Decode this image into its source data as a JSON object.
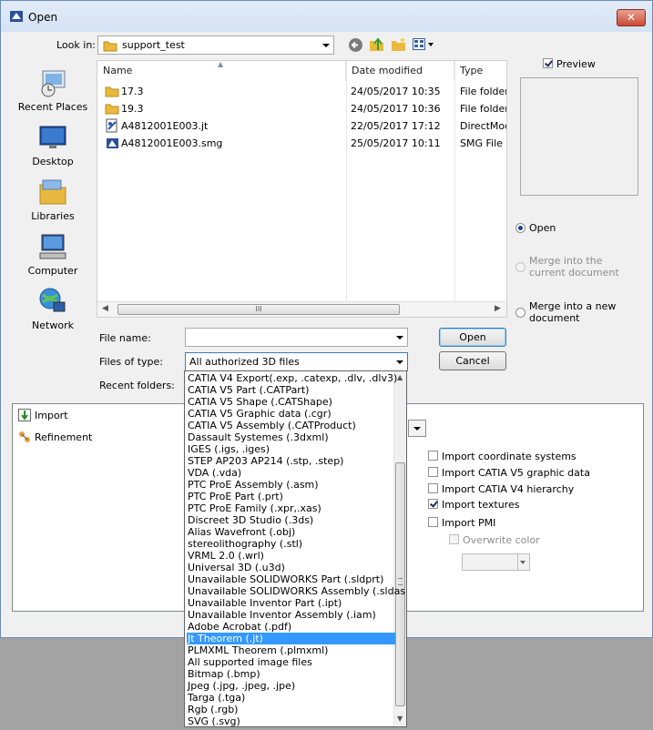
{
  "window": {
    "title": "Open",
    "close_glyph": "✕"
  },
  "toolbar": {
    "lookin_label": "Look in:",
    "lookin_value": "support_test"
  },
  "places": [
    {
      "label": "Recent Places",
      "icon": "recent-places-icon"
    },
    {
      "label": "Desktop",
      "icon": "desktop-icon"
    },
    {
      "label": "Libraries",
      "icon": "libraries-icon"
    },
    {
      "label": "Computer",
      "icon": "computer-icon"
    },
    {
      "label": "Network",
      "icon": "network-icon"
    }
  ],
  "filelist": {
    "columns": [
      "Name",
      "Date modified",
      "Type"
    ],
    "rows": [
      {
        "name": "17.3",
        "date": "24/05/2017 10:35",
        "type": "File folder",
        "icon": "folder-icon"
      },
      {
        "name": "19.3",
        "date": "24/05/2017 10:36",
        "type": "File folder",
        "icon": "folder-icon"
      },
      {
        "name": "A4812001E003.jt",
        "date": "22/05/2017 17:12",
        "type": "DirectMod",
        "icon": "jt-file-icon"
      },
      {
        "name": "A4812001E003.smg",
        "date": "25/05/2017 10:11",
        "type": "SMG File",
        "icon": "smg-file-icon"
      }
    ],
    "scroll_grip": "III"
  },
  "form": {
    "filename_label": "File name:",
    "filename_value": "",
    "filetype_label": "Files of type:",
    "filetype_value": "All authorized 3D files",
    "recent_label": "Recent folders:"
  },
  "buttons": {
    "open": "Open",
    "cancel": "Cancel"
  },
  "preview": {
    "label": "Preview",
    "checked": true
  },
  "options": {
    "open": "Open",
    "merge_current": "Merge into the current document",
    "merge_new": "Merge into a new document"
  },
  "tree": {
    "import": "Import",
    "refinement": "Refinement"
  },
  "import_options": [
    {
      "label": "Import coordinate systems",
      "checked": false
    },
    {
      "label": "Import CATIA V5 graphic data",
      "checked": false
    },
    {
      "label": "Import CATIA V4 hierarchy",
      "checked": false
    },
    {
      "label": "Import textures",
      "checked": true
    },
    {
      "label": "Import PMI",
      "checked": false
    },
    {
      "label": "Overwrite color",
      "checked": false
    }
  ],
  "filetypes": [
    "CATIA V4 Export(.exp, .catexp, .dlv, .dlv3)",
    "CATIA V5 Part (.CATPart)",
    "CATIA V5 Shape (.CATShape)",
    "CATIA V5 Graphic data (.cgr)",
    "CATIA V5 Assembly (.CATProduct)",
    "Dassault Systemes (.3dxml)",
    "IGES (.igs, .iges)",
    "STEP AP203 AP214 (.stp, .step)",
    "VDA (.vda)",
    "PTC ProE Assembly (.asm)",
    "PTC ProE Part (.prt)",
    "PTC ProE Family (.xpr,.xas)",
    "Discreet 3D Studio (.3ds)",
    "Alias Wavefront (.obj)",
    "stereolithography (.stl)",
    "VRML 2.0 (.wrl)",
    "Universal 3D (.u3d)",
    "Unavailable SOLIDWORKS Part (.sldprt)",
    "Unavailable SOLIDWORKS Assembly (.sldasm)",
    "Unavailable Inventor Part (.ipt)",
    "Unavailable Inventor Assembly (.iam)",
    "Adobe Acrobat (.pdf)",
    "Jt Theorem (.jt)",
    "PLMXML Theorem (.plmxml)",
    "All supported image files",
    "Bitmap (.bmp)",
    "Jpeg (.jpg, .jpeg, .jpe)",
    "Targa (.tga)",
    "Rgb (.rgb)",
    "SVG (.svg)"
  ],
  "selected_filetype_index": 22,
  "colors": {
    "selection": "#3399ff",
    "accent": "#3c7fb1"
  }
}
